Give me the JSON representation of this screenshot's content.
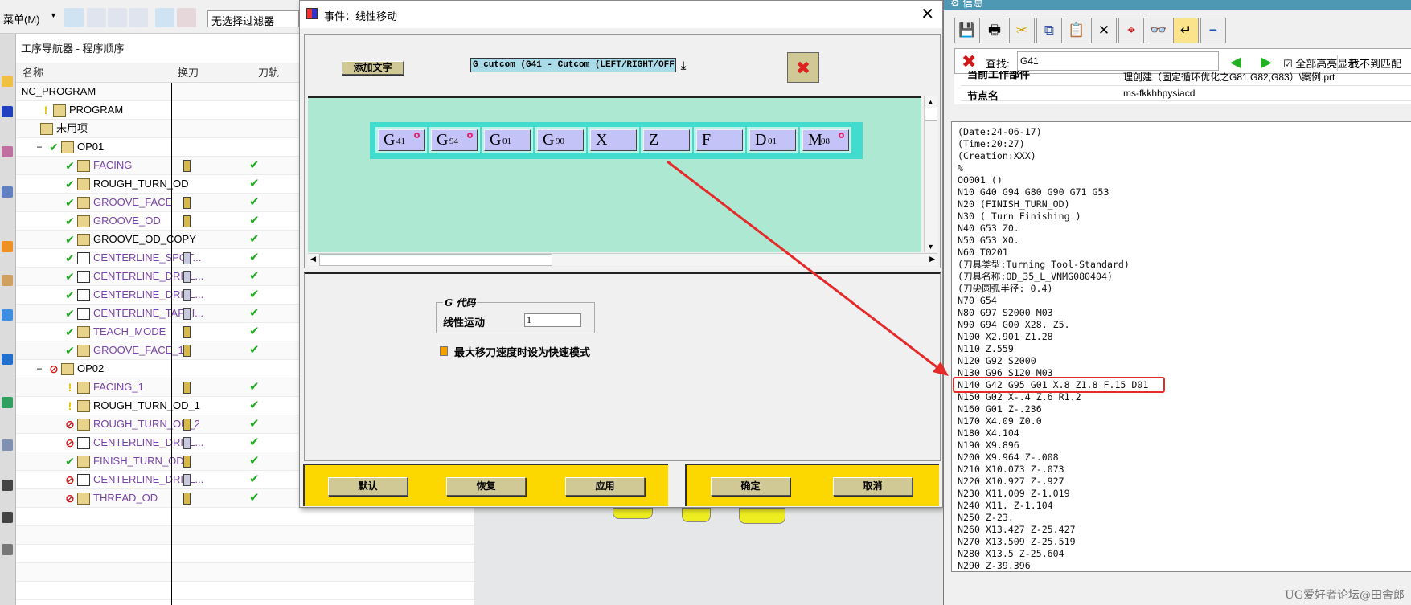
{
  "toolbar": {
    "menu_label": "菜单(M)",
    "filter_value": "无选择过滤器"
  },
  "navigator": {
    "title": "工序导航器 - 程序顺序",
    "columns": [
      "名称",
      "换刀",
      "刀轨"
    ],
    "rows": [
      {
        "name": "NC_PROGRAM",
        "level": 0,
        "status": "",
        "type": "",
        "purple": false,
        "tool": "",
        "path": false
      },
      {
        "name": "PROGRAM",
        "level": 1,
        "status": "bulb",
        "type": "folder",
        "purple": false,
        "tool": "",
        "path": false
      },
      {
        "name": "未用项",
        "level": 1,
        "status": "",
        "type": "folder",
        "purple": false,
        "tool": "",
        "path": false
      },
      {
        "name": "OP01",
        "level": 1,
        "status": "ok",
        "type": "folder",
        "purple": false,
        "tool": "",
        "path": false,
        "expand": "−"
      },
      {
        "name": "FACING",
        "level": 2,
        "status": "ok",
        "type": "op",
        "purple": true,
        "tool": "turn",
        "path": true
      },
      {
        "name": "ROUGH_TURN_OD",
        "level": 2,
        "status": "ok",
        "type": "op",
        "purple": false,
        "tool": "",
        "path": true
      },
      {
        "name": "GROOVE_FACE",
        "level": 2,
        "status": "ok",
        "type": "op",
        "purple": true,
        "tool": "turn",
        "path": true
      },
      {
        "name": "GROOVE_OD",
        "level": 2,
        "status": "ok",
        "type": "op",
        "purple": true,
        "tool": "turn",
        "path": true
      },
      {
        "name": "GROOVE_OD_COPY",
        "level": 2,
        "status": "ok",
        "type": "op",
        "purple": false,
        "tool": "",
        "path": true
      },
      {
        "name": "CENTERLINE_SPOT...",
        "level": 2,
        "status": "ok",
        "type": "drillop",
        "purple": true,
        "tool": "drill",
        "path": true
      },
      {
        "name": "CENTERLINE_DRILL...",
        "level": 2,
        "status": "ok",
        "type": "drillop",
        "purple": true,
        "tool": "drill",
        "path": true
      },
      {
        "name": "CENTERLINE_DRILL...",
        "level": 2,
        "status": "ok",
        "type": "drillop",
        "purple": true,
        "tool": "drill",
        "path": true
      },
      {
        "name": "CENTERLINE_TAPPI...",
        "level": 2,
        "status": "ok",
        "type": "drillop",
        "purple": true,
        "tool": "drill",
        "path": true
      },
      {
        "name": "TEACH_MODE",
        "level": 2,
        "status": "ok",
        "type": "op",
        "purple": true,
        "tool": "turn",
        "path": true
      },
      {
        "name": "GROOVE_FACE_1",
        "level": 2,
        "status": "ok",
        "type": "op",
        "purple": true,
        "tool": "turn",
        "path": true
      },
      {
        "name": "OP02",
        "level": 1,
        "status": "no",
        "type": "folder",
        "purple": false,
        "tool": "",
        "path": false,
        "expand": "−"
      },
      {
        "name": "FACING_1",
        "level": 2,
        "status": "bulb",
        "type": "op",
        "purple": true,
        "tool": "turn",
        "path": true
      },
      {
        "name": "ROUGH_TURN_OD_1",
        "level": 2,
        "status": "bulb",
        "type": "op",
        "purple": false,
        "tool": "",
        "path": true
      },
      {
        "name": "ROUGH_TURN_OD_2",
        "level": 2,
        "status": "no",
        "type": "op",
        "purple": true,
        "tool": "turn",
        "path": true
      },
      {
        "name": "CENTERLINE_DRILL...",
        "level": 2,
        "status": "no",
        "type": "drillop",
        "purple": true,
        "tool": "drill",
        "path": true
      },
      {
        "name": "FINISH_TURN_OD",
        "level": 2,
        "status": "ok",
        "type": "op",
        "purple": true,
        "tool": "turn",
        "path": true
      },
      {
        "name": "CENTERLINE_DRILL...",
        "level": 2,
        "status": "no",
        "type": "drillop",
        "purple": true,
        "tool": "drill",
        "path": true
      },
      {
        "name": "THREAD_OD",
        "level": 2,
        "status": "no",
        "type": "op",
        "purple": true,
        "tool": "turn",
        "path": true
      }
    ]
  },
  "dialog": {
    "title": "事件：线性移动",
    "add_text_label": "添加文字",
    "dropdown_value": "G_cutcom (G41 - Cutcom (LEFT/RIGHT/OFF))",
    "blocks": [
      {
        "letter": "G",
        "sub": "41",
        "marker": true
      },
      {
        "letter": "G",
        "sub": "94",
        "marker": true
      },
      {
        "letter": "G",
        "sub": "01",
        "marker": false
      },
      {
        "letter": "G",
        "sub": "90",
        "marker": false
      },
      {
        "letter": "X",
        "sub": "",
        "marker": false
      },
      {
        "letter": "Z",
        "sub": "",
        "marker": false
      },
      {
        "letter": "F",
        "sub": "",
        "marker": false
      },
      {
        "letter": "D",
        "sub": "01",
        "marker": false
      },
      {
        "letter": "M",
        "sub": "08",
        "marker": true
      }
    ],
    "group_label": "G 代码",
    "linear_label": "线性运动",
    "linear_value": "1",
    "rapid_checkbox_label": "最大移刀速度时设为快速模式",
    "buttons": {
      "default": "默认",
      "restore": "恢复",
      "apply": "应用",
      "ok": "确定",
      "cancel": "取消"
    }
  },
  "info": {
    "title": "信息",
    "search_label": "查找:",
    "search_value": "G41",
    "highlight_all_label": "全部高亮显示",
    "highlight_all_checked": true,
    "no_match_label": "找不到匹配",
    "properties": [
      {
        "key": "当前工作部件",
        "value": "理创建（固定循环优化之G81,G82,G83）\\案例.prt"
      },
      {
        "key": "节点名",
        "value": "ms-fkkhhpysiacd"
      }
    ],
    "code_lines": [
      "(Date:24-06-17)",
      "(Time:20:27)",
      "(Creation:XXX)",
      "%",
      "O0001 ()",
      "N10 G40 G94 G80 G90 G71 G53",
      "N20 (FINISH_TURN_OD)",
      "N30 ( Turn Finishing )",
      "N40 G53 Z0.",
      "N50 G53 X0.",
      "N60 T0201",
      "(刀具类型:Turning Tool-Standard)",
      "(刀具名称:OD_35_L_VNMG080404)",
      "(刀尖圆弧半径: 0.4)",
      "N70 G54",
      "N80 G97 S2000 M03",
      "N90 G94 G00 X28. Z5.",
      "N100 X2.901 Z1.28",
      "N110 Z.559",
      "N120 G92 S2000",
      "N130 G96 S120 M03",
      "N140 G42 G95 G01 X.8 Z1.8 F.15 D01",
      "N150 G02 X-.4 Z.6 R1.2",
      "N160 G01 Z-.236",
      "N170 X4.09 Z0.0",
      "N180 X4.104",
      "N190 X9.896",
      "N200 X9.964 Z-.008",
      "N210 X10.073 Z-.073",
      "N220 X10.927 Z-.927",
      "N230 X11.009 Z-1.019",
      "N240 X11. Z-1.104",
      "N250 Z-23.",
      "N260 X13.427 Z-25.427",
      "N270 X13.509 Z-25.519",
      "N280 X13.5 Z-25.604",
      "N290 Z-39.396"
    ],
    "highlighted_line": "N140 G42 G95 G01 X.8 Z1.8 F.15 D01"
  },
  "watermark": "UG爱好者论坛@田舍郎",
  "colors": {
    "dialog_canvas": "#ade8d2",
    "block_strip": "#42dccf",
    "block": "#c3c3f8",
    "button_bar": "#fdd700",
    "info_title": "#4e98b4",
    "annotation": "#e62a2a",
    "op_purple": "#7a45a8"
  }
}
